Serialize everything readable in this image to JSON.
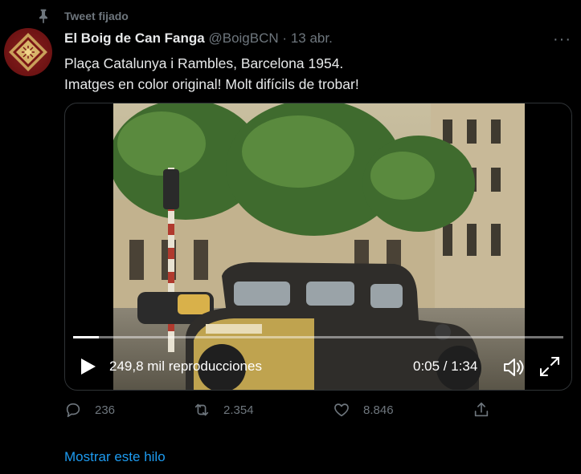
{
  "pinned": {
    "label": "Tweet fijado",
    "icon": "pin-icon"
  },
  "author": {
    "name": "El Boig de Can Fanga",
    "handle": "@BoigBCN",
    "separator": "·",
    "date": "13 abr."
  },
  "tweet": {
    "lines": [
      "Plaça Catalunya i Rambles, Barcelona 1954.",
      "Imatges en color original! Molt difícils de trobar!"
    ]
  },
  "video": {
    "views": "249,8 mil reproducciones",
    "time": "0:05 / 1:34",
    "progress_fraction": 0.053,
    "icons": [
      "play-icon",
      "volume-icon",
      "fullscreen-icon"
    ]
  },
  "actions": {
    "replies": "236",
    "retweets": "2.354",
    "likes": "8.846"
  },
  "show_thread": "Mostrar este hilo",
  "colors": {
    "background": "#000000",
    "muted": "#6e767d",
    "link": "#1d9bf0",
    "text": "#e7e9ea"
  }
}
